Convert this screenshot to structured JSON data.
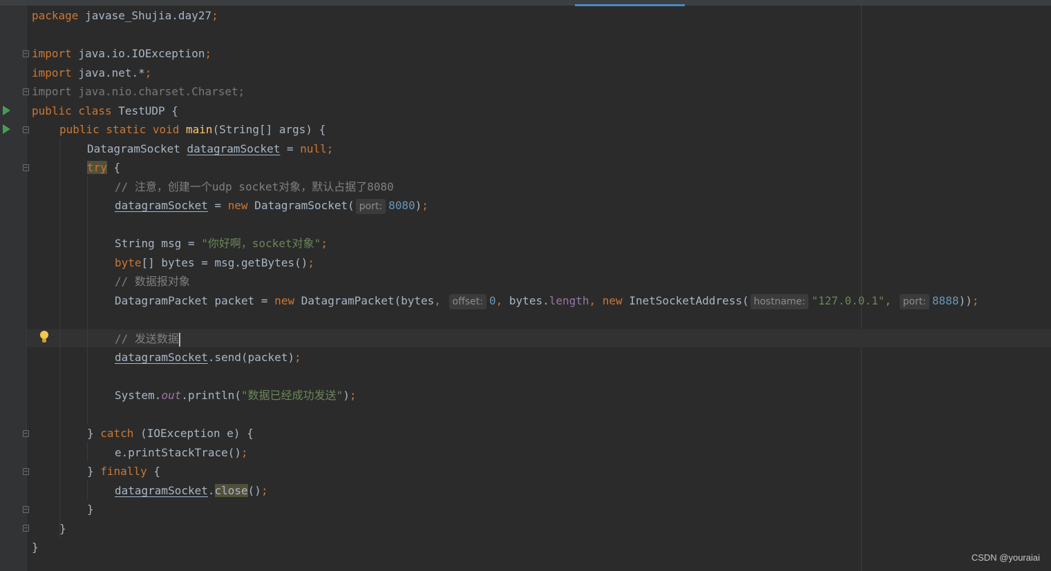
{
  "editor": {
    "lines": {
      "l1": {
        "kw_package": "package",
        "pkg_name": " javase_Shujia.day27",
        "semi": ";"
      },
      "l3": {
        "kw_import": "import",
        "path": " java.io.IOException",
        "semi": ";"
      },
      "l4": {
        "kw_import": "import",
        "path": " java.net.*",
        "semi": ";"
      },
      "l5": {
        "text": "import java.nio.charset.Charset;"
      },
      "l6": {
        "kw": "public class",
        "rest": " TestUDP {"
      },
      "l7": {
        "kw": "public static void",
        "method": "main",
        "rest": "(String[] args) {"
      },
      "l8": {
        "type": "DatagramSocket ",
        "var": "datagramSocket",
        "op": " = ",
        "null": "null",
        "semi": ";"
      },
      "l9": {
        "kw_try": "try",
        "rest": " {"
      },
      "l10": {
        "comment": "// 注意，创建一个udp socket对象，默认占据了8080"
      },
      "l11": {
        "var": "datagramSocket",
        "op": " = ",
        "kw_new": "new",
        "ctor": " DatagramSocket(",
        "hint_port": "port:",
        "port": "8080",
        "close": ")",
        "semi": ";"
      },
      "l13": {
        "decl": "String msg = ",
        "str": "\"你好啊，socket对象\"",
        "semi": ";"
      },
      "l14": {
        "kw_byte": "byte",
        "rest": "[] bytes = msg.getBytes()",
        "semi": ";"
      },
      "l15": {
        "comment": "// 数据报对象"
      },
      "l16": {
        "decl": "DatagramPacket packet = ",
        "kw_new1": "new",
        "ctor": " DatagramPacket(bytes",
        "comma1": ",",
        "hint_offset": "offset:",
        "offset": "0",
        "comma2": ",",
        "bytes_dot": " bytes.",
        "length": "length",
        "comma3": ",",
        "kw_new2": " new",
        "ctor2": " InetSocketAddress(",
        "hint_hostname": "hostname:",
        "hostname": "\"127.0.0.1\"",
        "comma4": ",",
        "hint_port": "port:",
        "port": "8888",
        "close": "))",
        "semi": ";"
      },
      "l18": {
        "comment": "// 发送数据"
      },
      "l19": {
        "var": "datagramSocket",
        "rest": ".send(packet)",
        "semi": ";"
      },
      "l21": {
        "prefix": "System.",
        "out": "out",
        "mid": ".println(",
        "str": "\"数据已经成功发送\"",
        "close": ")",
        "semi": ";"
      },
      "l23": {
        "pre": "} ",
        "kw_catch": "catch",
        "rest": " (IOException e) {"
      },
      "l24": {
        "rest": "e.printStackTrace()",
        "semi": ";"
      },
      "l25": {
        "pre": "} ",
        "kw_finally": "finally",
        "rest": " {"
      },
      "l26": {
        "var": "datagramSocket",
        "dot": ".",
        "method": "close",
        "rest": "()",
        "semi": ";"
      },
      "l27": {
        "text": "}"
      },
      "l28": {
        "text": "}"
      },
      "l29": {
        "text": "}"
      }
    },
    "colors": {
      "background": "#2b2b2b",
      "keyword": "#cc7832",
      "string": "#6a8759",
      "number": "#6897bb",
      "comment": "#808080",
      "method": "#ffc66d",
      "field": "#9876aa",
      "text": "#a9b7c6"
    },
    "gutter_icons": [
      "run-icon",
      "run-icon",
      "fold-icon",
      "bulb-icon"
    ]
  },
  "watermark": "CSDN @youraiai"
}
